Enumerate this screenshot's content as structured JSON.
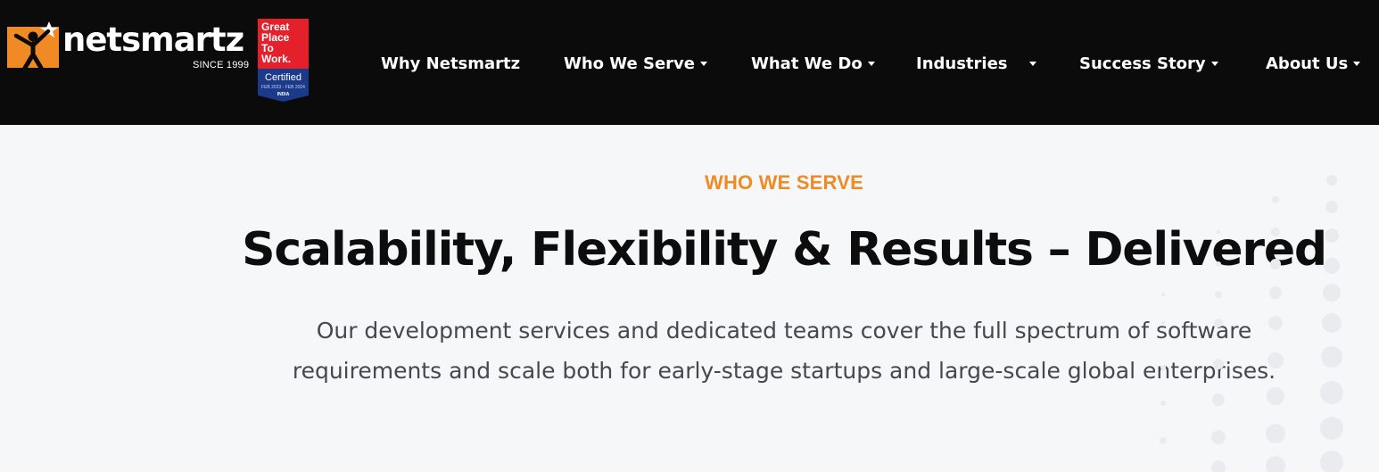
{
  "brand": {
    "name": "netsmartz",
    "since": "SINCE 1999"
  },
  "badge": {
    "lines": [
      "Great",
      "Place",
      "To",
      "Work."
    ],
    "certified": "Certified",
    "dates": "FEB 2023 - FEB 2024",
    "country": "INDIA"
  },
  "nav": [
    {
      "label": "Why Netsmartz",
      "dropdown": false
    },
    {
      "label": "Who We Serve",
      "dropdown": true
    },
    {
      "label": "What We Do",
      "dropdown": true
    },
    {
      "label": "Industries",
      "dropdown": true
    },
    {
      "label": "Success Story",
      "dropdown": true
    },
    {
      "label": "About Us",
      "dropdown": true
    }
  ],
  "hero": {
    "eyebrow": "WHO WE SERVE",
    "title": "Scalability, Flexibility & Results – Delivered",
    "body_line1": "Our development services and dedicated teams cover the full spectrum of software",
    "body_line2": "requirements and scale both for early-stage startups and large-scale global enterprises."
  },
  "colors": {
    "navbar_bg": "#0b0b0b",
    "accent_orange": "#f08a24",
    "badge_red": "#e4202b",
    "badge_navy": "#1c3a8a",
    "page_bg": "#f6f7f9",
    "headline": "#0d0d0d",
    "body_text": "#46474f"
  }
}
